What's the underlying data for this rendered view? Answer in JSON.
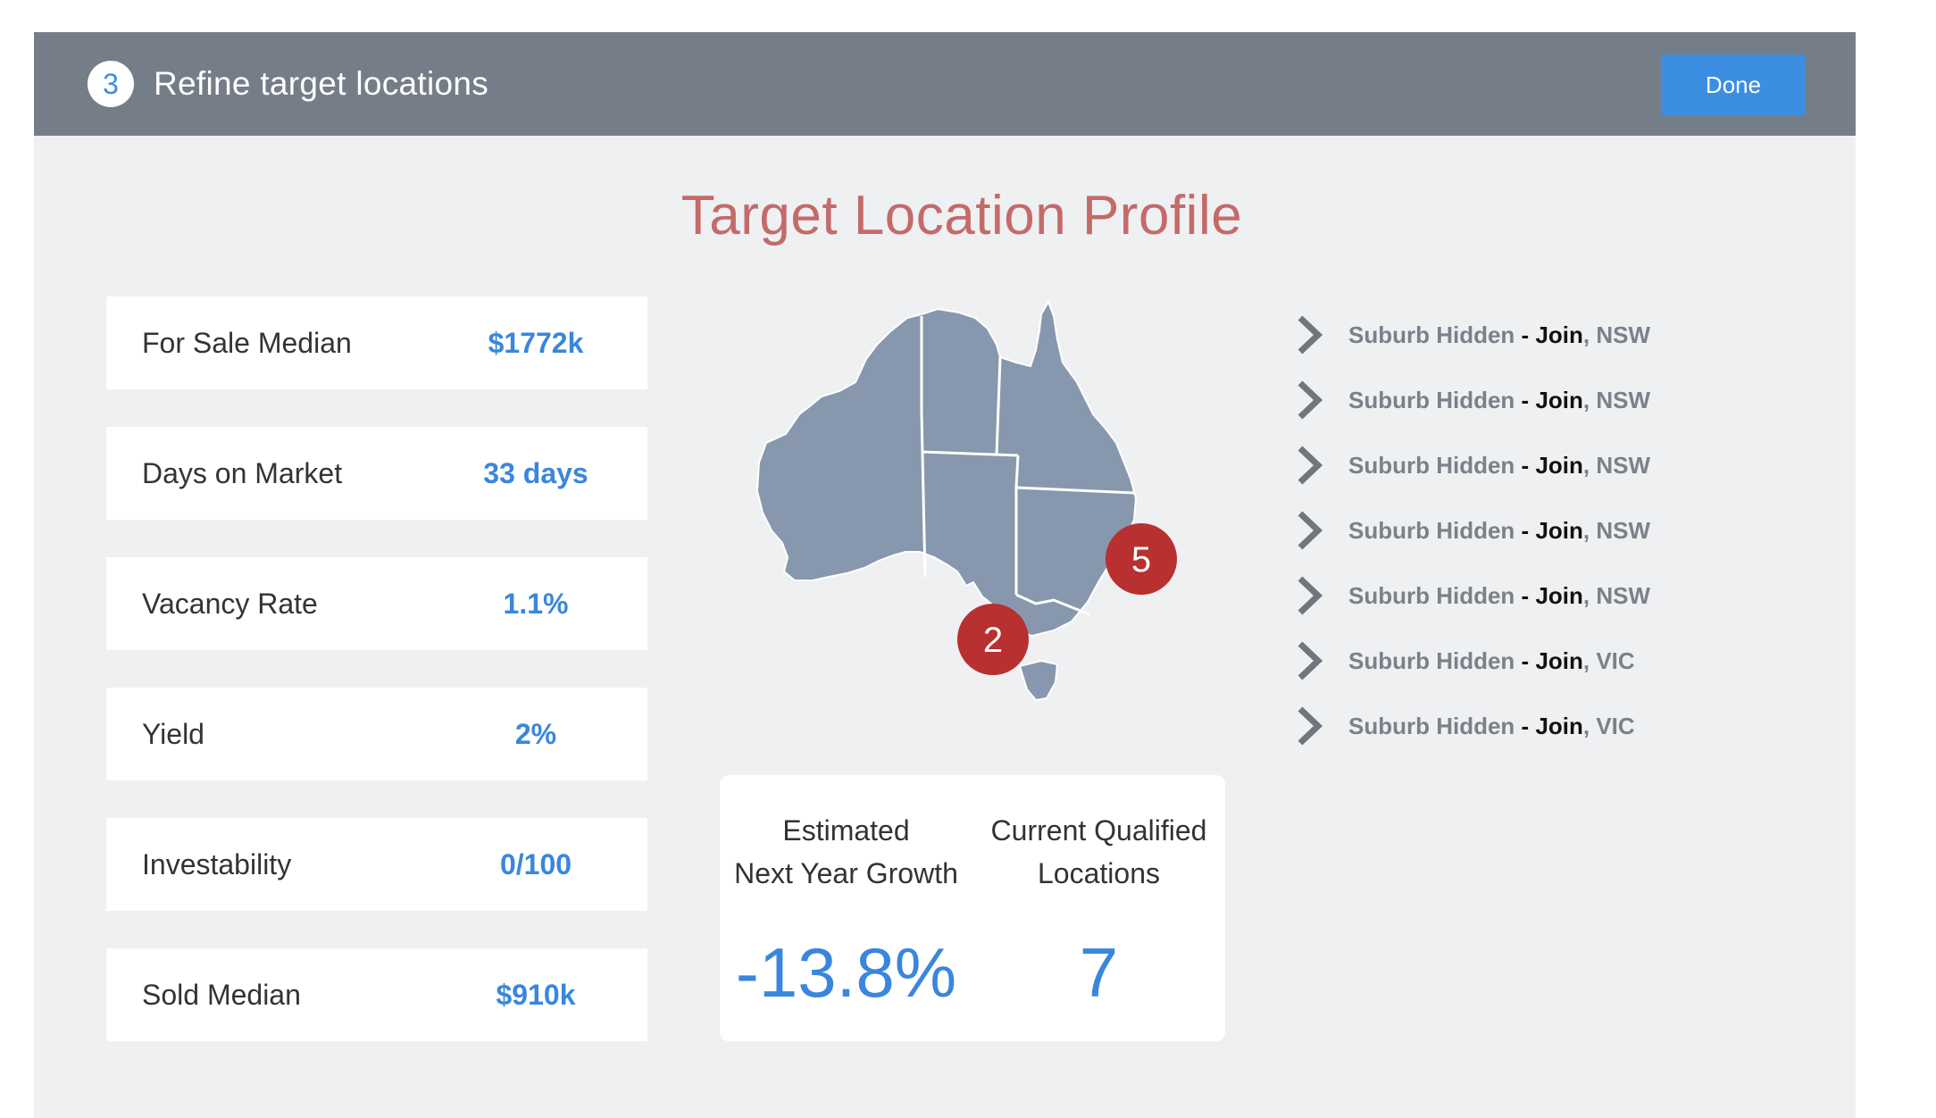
{
  "header": {
    "step_number": "3",
    "title": "Refine target locations",
    "done_label": "Done"
  },
  "profile": {
    "title": "Target Location Profile"
  },
  "stats": [
    {
      "label": "For Sale Median",
      "value": "$1772k"
    },
    {
      "label": "Days on Market",
      "value": "33 days"
    },
    {
      "label": "Vacancy Rate",
      "value": "1.1%"
    },
    {
      "label": "Yield",
      "value": "2%"
    },
    {
      "label": "Investability",
      "value": "0/100"
    },
    {
      "label": "Sold Median",
      "value": "$910k"
    }
  ],
  "map": {
    "markers": [
      {
        "label": "5",
        "state": "NSW"
      },
      {
        "label": "2",
        "state": "VIC"
      }
    ]
  },
  "summary": {
    "growth_label_line1": "Estimated",
    "growth_label_line2": "Next Year Growth",
    "growth_value": "-13.8%",
    "locations_label_line1": "Current Qualified",
    "locations_label_line2": "Locations",
    "locations_value": "7"
  },
  "suburbs": [
    {
      "name": "Suburb Hidden",
      "sep": " - ",
      "join": "Join",
      "state": ", NSW"
    },
    {
      "name": "Suburb Hidden",
      "sep": " - ",
      "join": "Join",
      "state": ", NSW"
    },
    {
      "name": "Suburb Hidden",
      "sep": " - ",
      "join": "Join",
      "state": ", NSW"
    },
    {
      "name": "Suburb Hidden",
      "sep": " - ",
      "join": "Join",
      "state": ", NSW"
    },
    {
      "name": "Suburb Hidden",
      "sep": " - ",
      "join": "Join",
      "state": ", NSW"
    },
    {
      "name": "Suburb Hidden",
      "sep": " - ",
      "join": "Join",
      "state": ", VIC"
    },
    {
      "name": "Suburb Hidden",
      "sep": " - ",
      "join": "Join",
      "state": ", VIC"
    }
  ],
  "colors": {
    "header_bg": "#757e88",
    "accent_blue": "#3c8ee3",
    "title_red": "#c46a6a",
    "marker_red": "#b8302f",
    "map_fill": "#8798ae"
  }
}
